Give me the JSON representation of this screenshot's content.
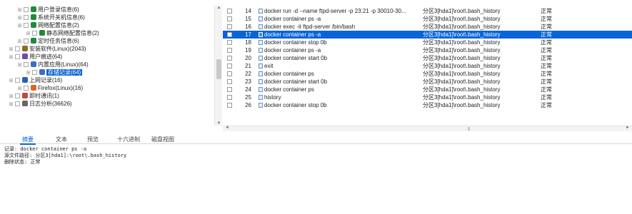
{
  "tree": {
    "items": [
      {
        "label": "用户登录信息(6)",
        "icon_color": "#1f8a3a"
      },
      {
        "label": "系统开关机信息(6)",
        "icon_color": "#1f8a3a"
      },
      {
        "label": "网络配置信息(2)",
        "icon_color": "#1f8a3a"
      },
      {
        "label": "静态网络配置信息(2)",
        "icon_color": "#1f8a3a"
      },
      {
        "label": "定时任务信息(6)",
        "icon_color": "#1f8a3a"
      },
      {
        "label": "安装软件(Linux)(2043)",
        "icon_color": "#8a6d1f"
      },
      {
        "label": "用户痕迹(64)",
        "icon_color": "#6a4fa3"
      },
      {
        "label": "内置应用(Linux)(64)",
        "icon_color": "#3a6fc1"
      },
      {
        "label": "存储记录(64)",
        "icon_color": "#3a6fc1"
      },
      {
        "label": "上网记录(16)",
        "icon_color": "#2a5fb8"
      },
      {
        "label": "Firefox(Linux)(16)",
        "icon_color": "#e0661f"
      },
      {
        "label": "即时通讯(1)",
        "icon_color": "#c14a3a"
      },
      {
        "label": "日志分析(36626)",
        "icon_color": "#666666"
      }
    ]
  },
  "grid": {
    "rows": [
      {
        "num": "14",
        "cmd": "docker run -d --name ftpd-server -p 23:21 -p 30010-30...",
        "path": "分区3[hda1]\\root\\.bash_history",
        "status": "正常"
      },
      {
        "num": "15",
        "cmd": "docker container ps -a",
        "path": "分区3[hda1]\\root\\.bash_history",
        "status": "正常"
      },
      {
        "num": "16",
        "cmd": "docker exec -it ftpd-server /bin/bash",
        "path": "分区3[hda1]\\root\\.bash_history",
        "status": "正常"
      },
      {
        "num": "17",
        "cmd": "docker container ps -a",
        "path": "分区3[hda1]\\root\\.bash_history",
        "status": "正常"
      },
      {
        "num": "18",
        "cmd": "docker container stop 0b",
        "path": "分区3[hda1]\\root\\.bash_history",
        "status": "正常"
      },
      {
        "num": "19",
        "cmd": "docker container ps -a",
        "path": "分区3[hda1]\\root\\.bash_history",
        "status": "正常"
      },
      {
        "num": "20",
        "cmd": "docker container start 0b",
        "path": "分区3[hda1]\\root\\.bash_history",
        "status": "正常"
      },
      {
        "num": "21",
        "cmd": "exit",
        "path": "分区3[hda1]\\root\\.bash_history",
        "status": "正常"
      },
      {
        "num": "22",
        "cmd": "docker container ps",
        "path": "分区3[hda1]\\root\\.bash_history",
        "status": "正常"
      },
      {
        "num": "23",
        "cmd": "docker container start 0b",
        "path": "分区3[hda1]\\root\\.bash_history",
        "status": "正常"
      },
      {
        "num": "24",
        "cmd": "docker container ps",
        "path": "分区3[hda1]\\root\\.bash_history",
        "status": "正常"
      },
      {
        "num": "25",
        "cmd": "history",
        "path": "分区3[hda1]\\root\\.bash_history",
        "status": "正常"
      },
      {
        "num": "26",
        "cmd": "docker container stop 0b",
        "path": "分区3[hda1]\\root\\.bash_history",
        "status": "正常"
      }
    ],
    "selected_num": "17"
  },
  "tabs": {
    "items": [
      "摘要",
      "文本",
      "预览",
      "十六进制",
      "磁盘视图"
    ],
    "active": "摘要"
  },
  "detail": {
    "lines": [
      "记录: docker container ps -a",
      "源文件路径: 分区3[hda1]:\\root\\.bash_history",
      "删除状态: 正常"
    ]
  },
  "colors": {
    "accent": "#0a64d8"
  }
}
